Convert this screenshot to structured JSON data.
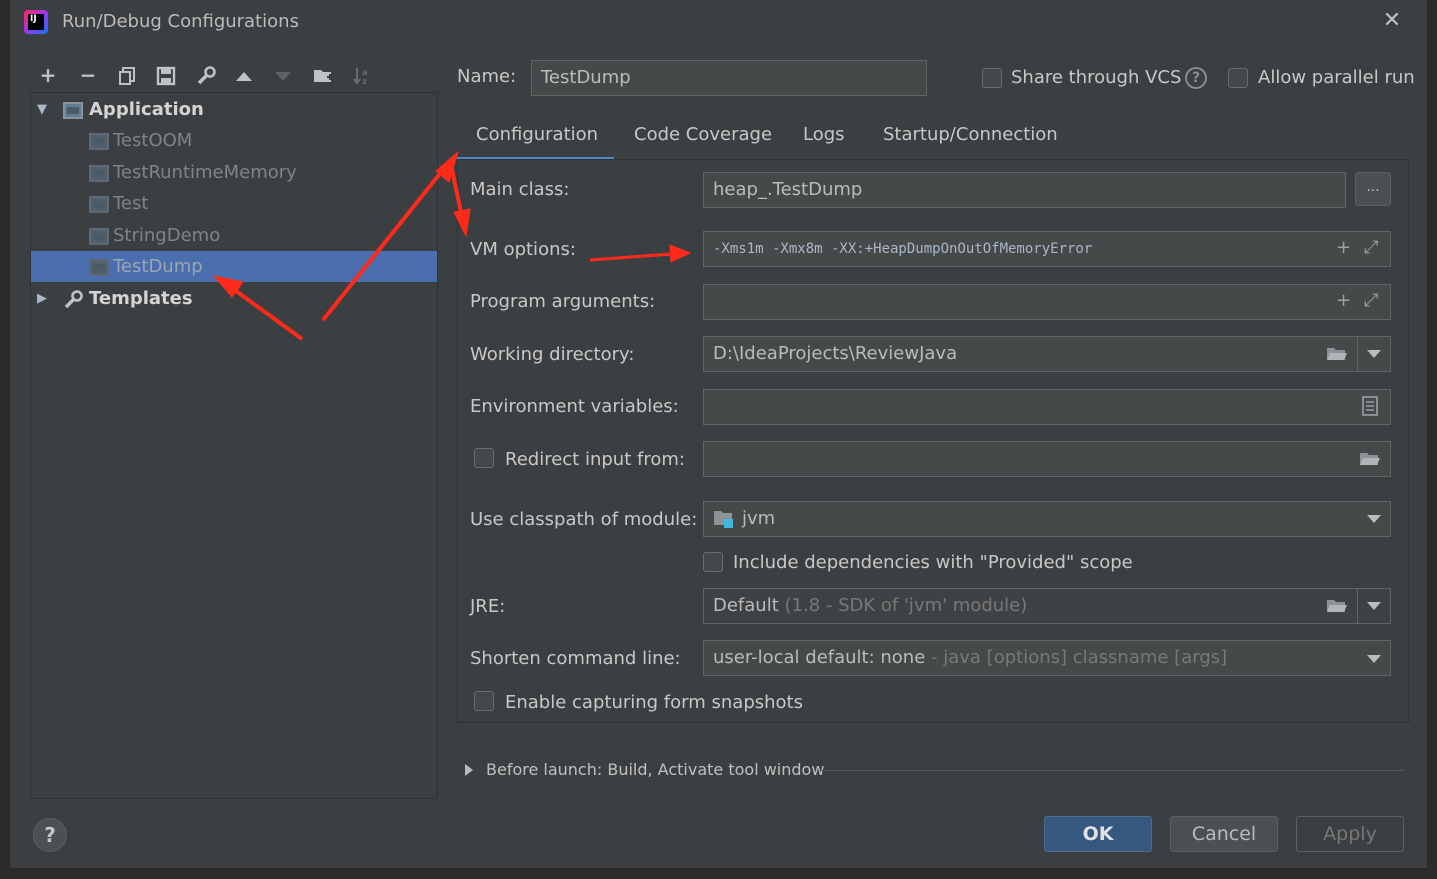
{
  "window": {
    "title": "Run/Debug Configurations",
    "close": "✕"
  },
  "toolbar": {
    "add": "+",
    "remove": "−"
  },
  "tree": {
    "application": "Application",
    "items": [
      "TestOOM",
      "TestRuntimeMemory",
      "Test",
      "StringDemo",
      "TestDump"
    ],
    "selected": "TestDump",
    "templates": "Templates"
  },
  "header": {
    "name_label": "Name:",
    "name_value": "TestDump",
    "share_vcs": "Share through VCS",
    "allow_parallel": "Allow parallel run"
  },
  "tabs": [
    "Configuration",
    "Code Coverage",
    "Logs",
    "Startup/Connection"
  ],
  "form": {
    "main_class_label": "Main class:",
    "main_class_value": "heap_.TestDump",
    "browse": "...",
    "vm_options_label": "VM options:",
    "vm_options_value": "-Xms1m -Xmx8m -XX:+HeapDumpOnOutOfMemoryError",
    "program_args_label": "Program arguments:",
    "program_args_value": "",
    "working_dir_label": "Working directory:",
    "working_dir_value": "D:\\IdeaProjects\\ReviewJava",
    "env_vars_label": "Environment variables:",
    "redirect_label": "Redirect input from:",
    "classpath_label": "Use classpath of module:",
    "classpath_value": "jvm",
    "include_deps": "Include dependencies with \"Provided\" scope",
    "jre_label": "JRE:",
    "jre_value": "Default",
    "jre_hint": " (1.8 - SDK of 'jvm' module)",
    "shorten_label": "Shorten command line:",
    "shorten_value": "user-local default: none",
    "shorten_hint": " - java [options] classname [args]",
    "snapshots": "Enable capturing form snapshots"
  },
  "before_launch": "Before launch: Build, Activate tool window",
  "buttons": {
    "ok": "OK",
    "cancel": "Cancel",
    "apply": "Apply",
    "help": "?"
  },
  "colors": {
    "accent": "#4a88c7",
    "selected": "#4b6eaf",
    "ok_button": "#365880",
    "annotation": "#ff2a1a"
  }
}
